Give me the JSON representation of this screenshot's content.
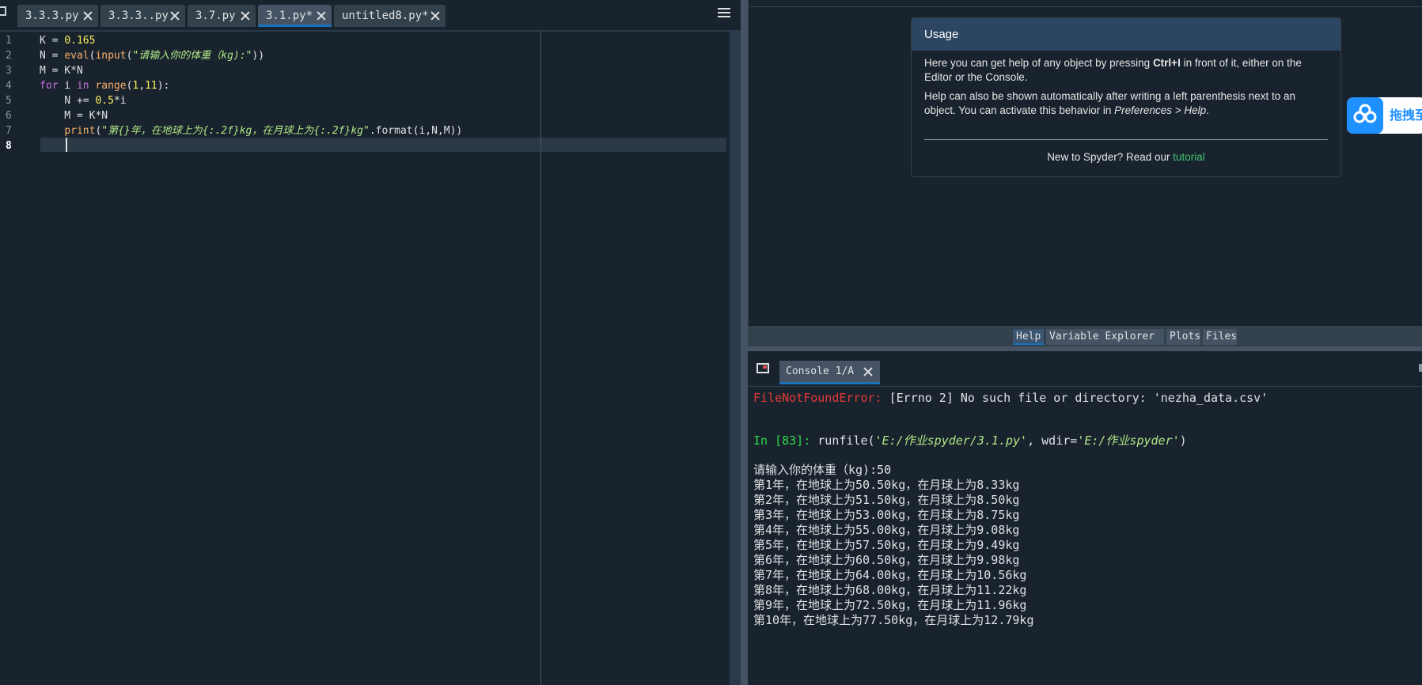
{
  "editor": {
    "tabs": [
      {
        "label": "3.3.3.py",
        "active": false
      },
      {
        "label": "3.3.3..py",
        "active": false
      },
      {
        "label": "3.7.py",
        "active": false
      },
      {
        "label": "3.1.py*",
        "active": true
      },
      {
        "label": "untitled8.py*",
        "active": false
      }
    ],
    "line_numbers": [
      "1",
      "2",
      "3",
      "4",
      "5",
      "6",
      "7",
      "8"
    ],
    "current_line": "8",
    "code": {
      "l1": {
        "a": "K = ",
        "b": "0.165"
      },
      "l2": {
        "a": "N = ",
        "b": "eval",
        "c": "(",
        "d": "input",
        "e": "(",
        "f": "\"请输入你的体重（kg):\"",
        "g": "))"
      },
      "l3": {
        "a": "M = K*N"
      },
      "l4": {
        "a": "for",
        "b": " i ",
        "c": "in",
        "d": " ",
        "e": "range",
        "f": "(",
        "g": "1",
        "h": ",",
        "i": "11",
        "j": "):"
      },
      "l5": {
        "a": "    N += ",
        "b": "0.5",
        "c": "*i"
      },
      "l6": {
        "a": "    M = K*N"
      },
      "l7": {
        "a": "    ",
        "b": "print",
        "c": "(",
        "d": "\"第{}年，在地球上为{:.2f}kg，在月球上为{:.2f}kg\"",
        "e": ".format(i,N,M))"
      }
    }
  },
  "help": {
    "usage_title": "Usage",
    "p1_a": "Here you can get help of any object by pressing ",
    "p1_b": "Ctrl+I",
    "p1_c": " in front of it, either on the Editor or the Console.",
    "p2_a": "Help can also be shown automatically after writing a left parenthesis next to an object. You can activate this behavior in ",
    "p2_b": "Preferences > Help",
    "p2_c": ".",
    "footer_text": "New to Spyder? Read our ",
    "footer_link": "tutorial",
    "tabs": [
      "Help",
      "Variable Explorer",
      "Plots",
      "Files"
    ]
  },
  "baidu_badge": {
    "text": "拖拽至"
  },
  "console": {
    "tab_label": "Console 1/A",
    "error_name": "FileNotFoundError:",
    "error_msg": " [Errno 2] No such file or directory: 'nezha_data.csv'",
    "prompt": "In [83]:",
    "cmd_a": " runfile(",
    "cmd_b": "'E:/作业spyder/3.1.py'",
    "cmd_c": ", wdir=",
    "cmd_d": "'E:/作业spyder'",
    "cmd_e": ")",
    "input_line": "请输入你的体重（kg):50",
    "output": [
      "第1年，在地球上为50.50kg，在月球上为8.33kg",
      "第2年，在地球上为51.50kg，在月球上为8.50kg",
      "第3年，在地球上为53.00kg，在月球上为8.75kg",
      "第4年，在地球上为55.00kg，在月球上为9.08kg",
      "第5年，在地球上为57.50kg，在月球上为9.49kg",
      "第6年，在地球上为60.50kg，在月球上为9.98kg",
      "第7年，在地球上为64.00kg，在月球上为10.56kg",
      "第8年，在地球上为68.00kg，在月球上为11.22kg",
      "第9年，在地球上为72.50kg，在月球上为11.96kg",
      "第10年，在地球上为77.50kg，在月球上为12.79kg"
    ]
  },
  "colors": {
    "background": "#19232d",
    "active_tab_accent": "#1a72bb",
    "keyword": "#c670e0",
    "number": "#faed5c",
    "builtin": "#fab16c",
    "string": "#b0e686",
    "error": "#e03a3a",
    "prompt": "#2fd94c",
    "link": "#3fc36f"
  }
}
